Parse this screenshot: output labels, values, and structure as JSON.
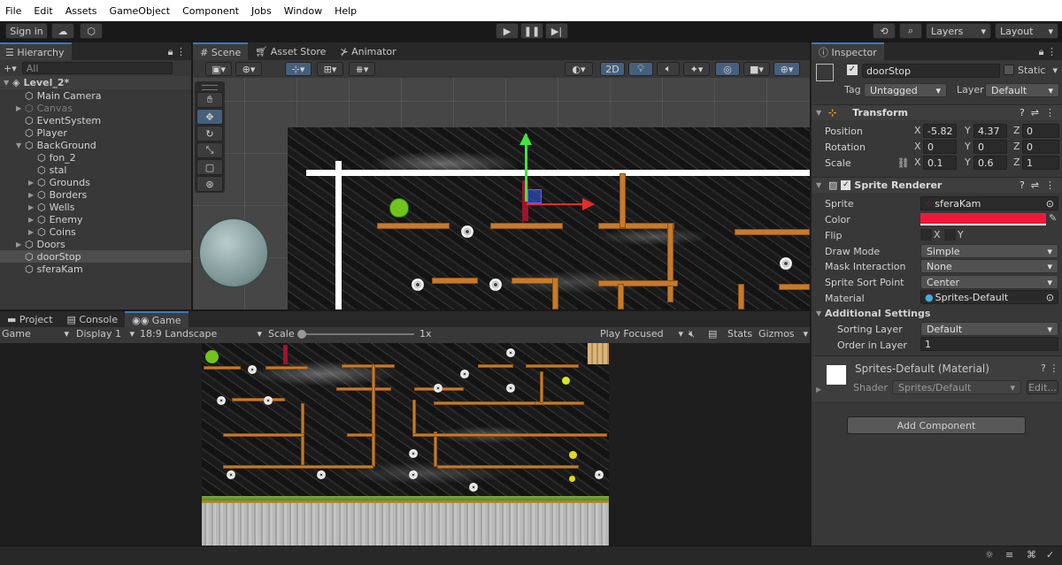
{
  "menu": [
    "File",
    "Edit",
    "Assets",
    "GameObject",
    "Component",
    "Jobs",
    "Window",
    "Help"
  ],
  "toolbar": {
    "sign_in": "Sign in",
    "layers": "Layers",
    "layout": "Layout"
  },
  "hierarchy": {
    "tab": "Hierarchy",
    "search_placeholder": "All",
    "scene": "Level_2*",
    "items": [
      {
        "label": "Main Camera",
        "indent": 1,
        "arrow": ""
      },
      {
        "label": "Canvas",
        "indent": 1,
        "arrow": "▶",
        "dim": true
      },
      {
        "label": "EventSystem",
        "indent": 1,
        "arrow": ""
      },
      {
        "label": "Player",
        "indent": 1,
        "arrow": ""
      },
      {
        "label": "BackGround",
        "indent": 1,
        "arrow": "▼"
      },
      {
        "label": "fon_2",
        "indent": 2,
        "arrow": ""
      },
      {
        "label": "stal",
        "indent": 2,
        "arrow": ""
      },
      {
        "label": "Grounds",
        "indent": 2,
        "arrow": "▶"
      },
      {
        "label": "Borders",
        "indent": 2,
        "arrow": "▶"
      },
      {
        "label": "Wells",
        "indent": 2,
        "arrow": "▶"
      },
      {
        "label": "Enemy",
        "indent": 2,
        "arrow": "▶"
      },
      {
        "label": "Coins",
        "indent": 2,
        "arrow": "▶"
      },
      {
        "label": "Doors",
        "indent": 1,
        "arrow": "▶"
      },
      {
        "label": "doorStop",
        "indent": 1,
        "arrow": "",
        "selected": true
      },
      {
        "label": "sferaKam",
        "indent": 1,
        "arrow": ""
      }
    ]
  },
  "scene_tabs": {
    "scene": "Scene",
    "asset_store": "Asset Store",
    "animator": "Animator",
    "mode_2d": "2D"
  },
  "bottom_tabs": {
    "project": "Project",
    "console": "Console",
    "game": "Game"
  },
  "game_bar": {
    "game": "Game",
    "display": "Display 1",
    "aspect": "18:9 Landscape",
    "scale_label": "Scale",
    "scale_value": "1x",
    "play_focused": "Play Focused",
    "stats": "Stats",
    "gizmos": "Gizmos"
  },
  "inspector": {
    "tab": "Inspector",
    "object_name": "doorStop",
    "static": "Static",
    "tag_label": "Tag",
    "tag": "Untagged",
    "layer_label": "Layer",
    "layer": "Default",
    "transform": {
      "title": "Transform",
      "position": "Position",
      "rotation": "Rotation",
      "scale": "Scale",
      "px": "-5.82",
      "py": "4.37",
      "pz": "0",
      "rx": "0",
      "ry": "0",
      "rz": "0",
      "sx": "0.1",
      "sy": "0.6",
      "sz": "1",
      "x": "X",
      "y": "Y",
      "z": "Z"
    },
    "sprite_renderer": {
      "title": "Sprite Renderer",
      "sprite_label": "Sprite",
      "sprite": "sferaKam",
      "color_label": "Color",
      "color": "#f0183a",
      "flip_label": "Flip",
      "flip_x": "X",
      "flip_y": "Y",
      "draw_mode_label": "Draw Mode",
      "draw_mode": "Simple",
      "mask_label": "Mask Interaction",
      "mask": "None",
      "sort_point_label": "Sprite Sort Point",
      "sort_point": "Center",
      "material_label": "Material",
      "material": "Sprites-Default",
      "additional": "Additional Settings",
      "sorting_layer_label": "Sorting Layer",
      "sorting_layer": "Default",
      "order_label": "Order in Layer",
      "order": "1"
    },
    "material_card": {
      "title": "Sprites-Default (Material)",
      "shader_label": "Shader",
      "shader": "Sprites/Default",
      "edit": "Edit..."
    },
    "add_component": "Add Component"
  },
  "colors": {
    "accent": "#3a79bb",
    "selected_row": "#2c5d87"
  }
}
